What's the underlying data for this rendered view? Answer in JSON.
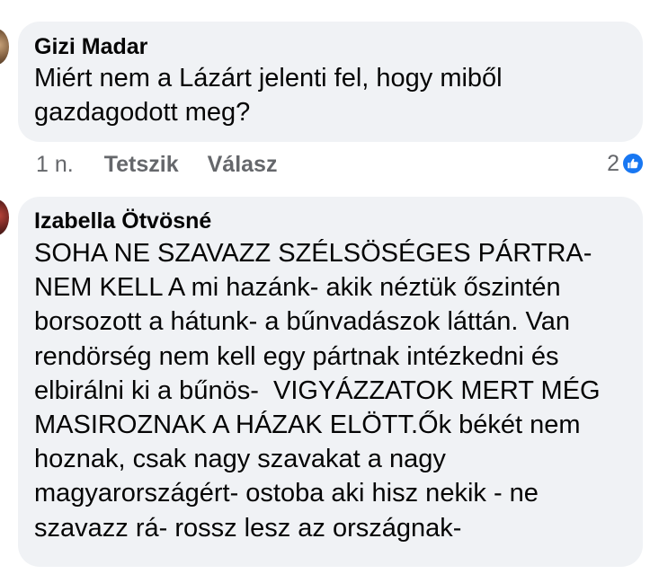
{
  "comments": [
    {
      "author": "Gizi Madar",
      "text": "Miért nem a Lázárt jelenti fel, hogy miből\ngazdagodott meg?",
      "time": "1 n.",
      "like_label": "Tetszik",
      "reply_label": "Válasz",
      "reaction_count": "2",
      "reaction_icon": "thumbs-up-icon",
      "avatar_icon": "avatar"
    },
    {
      "author": "Izabella Ötvösné",
      "text": "SOHA NE SZAVAZZ SZÉLSÖSÉGES PÁRTRA-\nNEM KELL A mi hazánk- akik néztük őszintén\nborsozott a hátunk- a bűnvadászok láttán. Van\nrendörség nem kell egy pártnak intézkedni és\nelbirálni ki a bűnös-  VIGYÁZZATOK MERT MÉG\nMASIROZNAK A HÁZAK ELÖTT.Ők békét nem\nhoznak, csak nagy szavakat a nagy\nmagyarországért- ostoba aki hisz nekik - ne\nszavazz rá- rossz lesz az országnak-",
      "avatar_icon": "avatar"
    }
  ],
  "colors": {
    "bubble": "#f0f2f5",
    "meta_text": "#65676b",
    "like_blue": "#1877f2"
  }
}
